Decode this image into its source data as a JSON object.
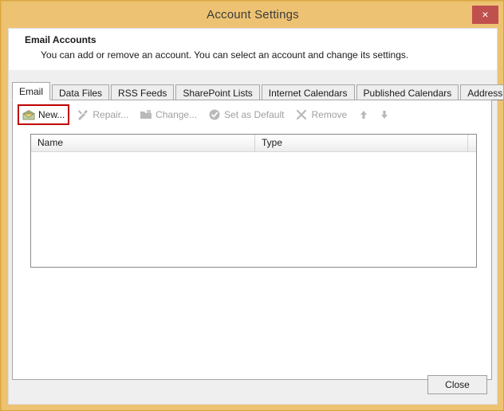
{
  "window": {
    "title": "Account Settings",
    "close_label": "×",
    "titlebar_color": "#edc373",
    "close_button_color": "#c0504d",
    "highlight_color": "#c00000"
  },
  "header": {
    "title": "Email Accounts",
    "subtitle": "You can add or remove an account. You can select an account and change its settings."
  },
  "tabs": [
    {
      "label": "Email",
      "active": true
    },
    {
      "label": "Data Files",
      "active": false
    },
    {
      "label": "RSS Feeds",
      "active": false
    },
    {
      "label": "SharePoint Lists",
      "active": false
    },
    {
      "label": "Internet Calendars",
      "active": false
    },
    {
      "label": "Published Calendars",
      "active": false
    },
    {
      "label": "Address Books",
      "active": false
    }
  ],
  "toolbar": [
    {
      "label": "New...",
      "icon": "new-mail-icon",
      "enabled": true,
      "highlighted": true
    },
    {
      "label": "Repair...",
      "icon": "repair-tools-icon",
      "enabled": false,
      "highlighted": false
    },
    {
      "label": "Change...",
      "icon": "change-folder-icon",
      "enabled": false,
      "highlighted": false
    },
    {
      "label": "Set as Default",
      "icon": "check-circle-icon",
      "enabled": false,
      "highlighted": false
    },
    {
      "label": "Remove",
      "icon": "x-mark-icon",
      "enabled": false,
      "highlighted": false
    }
  ],
  "toolbar_arrows": [
    {
      "icon": "arrow-up-icon",
      "label": "▲"
    },
    {
      "icon": "arrow-down-icon",
      "label": "▼"
    }
  ],
  "list": {
    "columns": [
      "Name",
      "Type",
      ""
    ],
    "rows": []
  },
  "footer": {
    "close_label": "Close"
  }
}
